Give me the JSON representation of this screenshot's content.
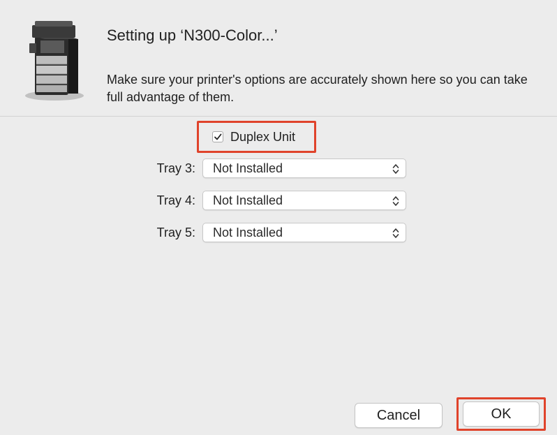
{
  "dialog": {
    "title": "Setting up ‘N300-Color...’",
    "message": "Make sure your printer's options are accurately shown here so you can take full advantage of them.",
    "icon": "printer-icon"
  },
  "options": {
    "duplex": {
      "label": "Duplex Unit",
      "checked": true
    },
    "trays": [
      {
        "label": "Tray 3:",
        "value": "Not Installed"
      },
      {
        "label": "Tray 4:",
        "value": "Not Installed"
      },
      {
        "label": "Tray 5:",
        "value": "Not Installed"
      }
    ]
  },
  "buttons": {
    "cancel": "Cancel",
    "ok": "OK"
  },
  "colors": {
    "highlight": "#e0432b",
    "background": "#ececec"
  }
}
